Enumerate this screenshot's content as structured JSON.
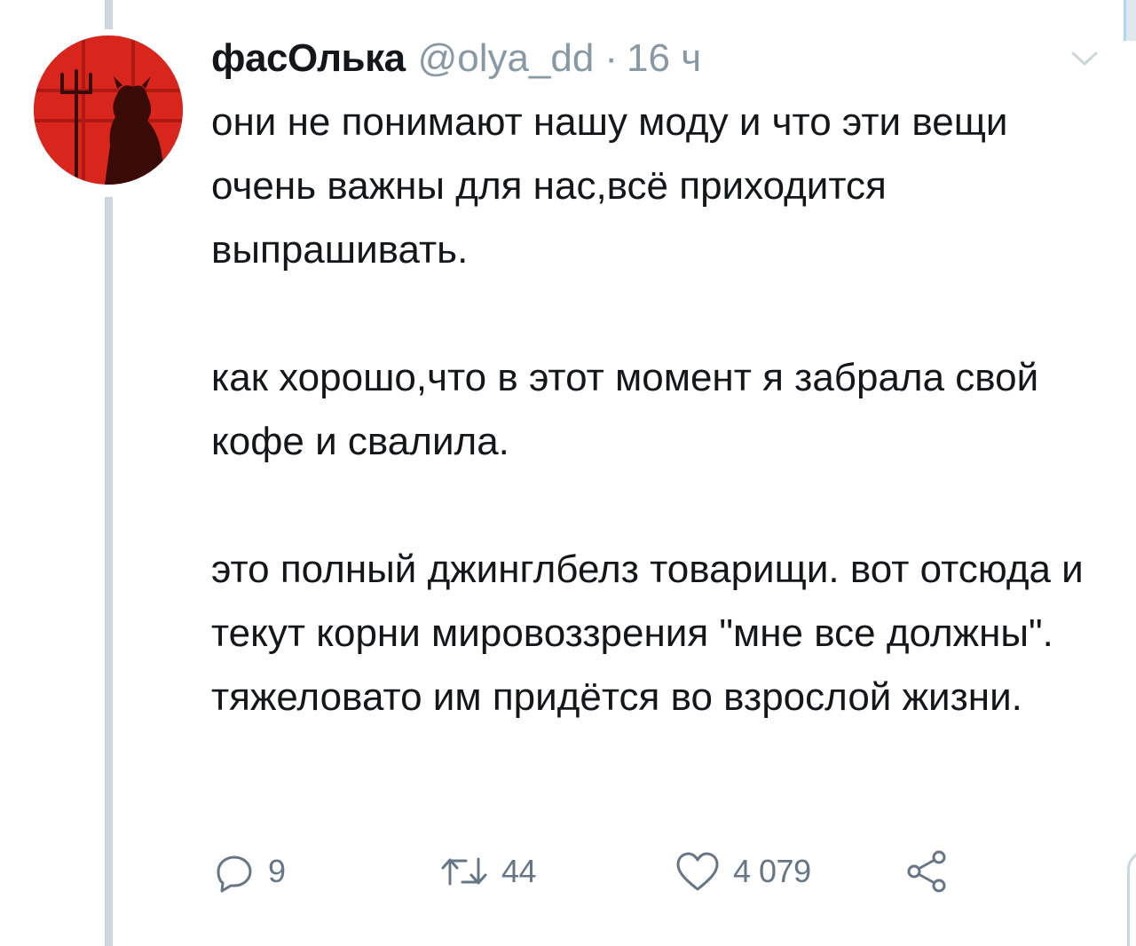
{
  "tweet": {
    "display_name": "фасОлька",
    "handle": "@olya_dd",
    "separator": "·",
    "time": "16 ч",
    "paragraphs": [
      "они не понимают нашу моду и что эти вещи очень важны для нас,всё приходится выпрашивать.",
      "как хорошо,что в этот момент я забрала свой кофе и свалила.",
      "это полный джинглбелз товарищи. вот отсюда и текут корни мировоззрения \"мне все должны\". тяжеловато им придётся во взрослой жизни."
    ]
  },
  "actions": {
    "reply": {
      "icon": "reply-icon",
      "count": "9"
    },
    "retweet": {
      "icon": "retweet-icon",
      "count": "44"
    },
    "like": {
      "icon": "heart-icon",
      "count": "4 079"
    },
    "share": {
      "icon": "share-icon"
    }
  },
  "colors": {
    "text": "#14171a",
    "secondary": "#8899a6",
    "icon": "#657786",
    "thread_line": "#ccd6dd",
    "avatar_bg": "#d9261c"
  }
}
